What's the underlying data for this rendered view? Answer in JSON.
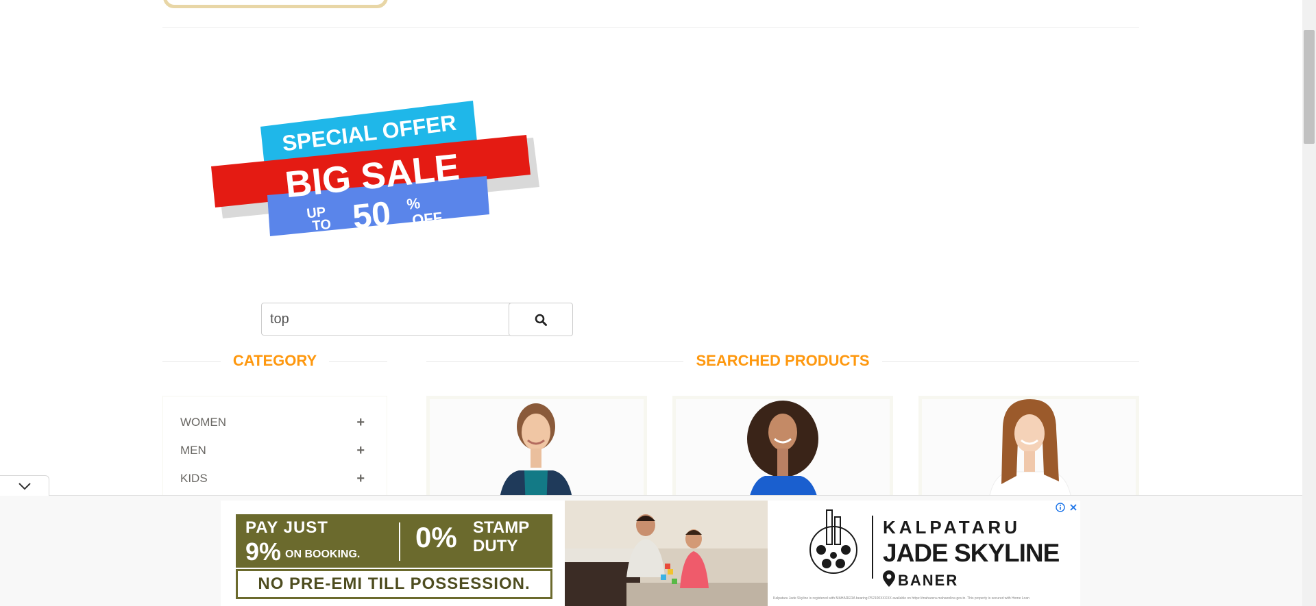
{
  "search": {
    "value": "top"
  },
  "sections": {
    "category_title": "CATEGORY",
    "products_title": "SEARCHED PRODUCTS"
  },
  "categories": [
    {
      "label": "WOMEN"
    },
    {
      "label": "MEN"
    },
    {
      "label": "KIDS"
    }
  ],
  "banner": {
    "line1": "SPECIAL OFFER",
    "line2": "BIG SALE",
    "up": "UP",
    "to": "TO",
    "percent": "50",
    "pct_sign": "%",
    "off": "OFF"
  },
  "ad": {
    "pay_just": "PAY JUST",
    "nine_pct": "9%",
    "on_booking": "ON BOOKING.",
    "zero_pct": "0%",
    "stamp_duty_1": "STAMP",
    "stamp_duty_2": "DUTY",
    "no_pre_emi": "NO PRE-EMI TILL POSSESSION.",
    "brand_name": "KALPATARU",
    "project": "JADE SKYLINE",
    "location": "BANER",
    "fine_print": "Kalpataru Jade Skyline is registered with MAHARERA bearing P52100XXXXX available on https://maharera.mahaonline.gov.in. This property is secured with Home Loan"
  },
  "colors": {
    "accent": "#fe980f",
    "olive": "#6b6a2d",
    "banner_red": "#e41b13",
    "banner_cyan": "#1fb7e9",
    "banner_blue": "#5a85ea"
  }
}
